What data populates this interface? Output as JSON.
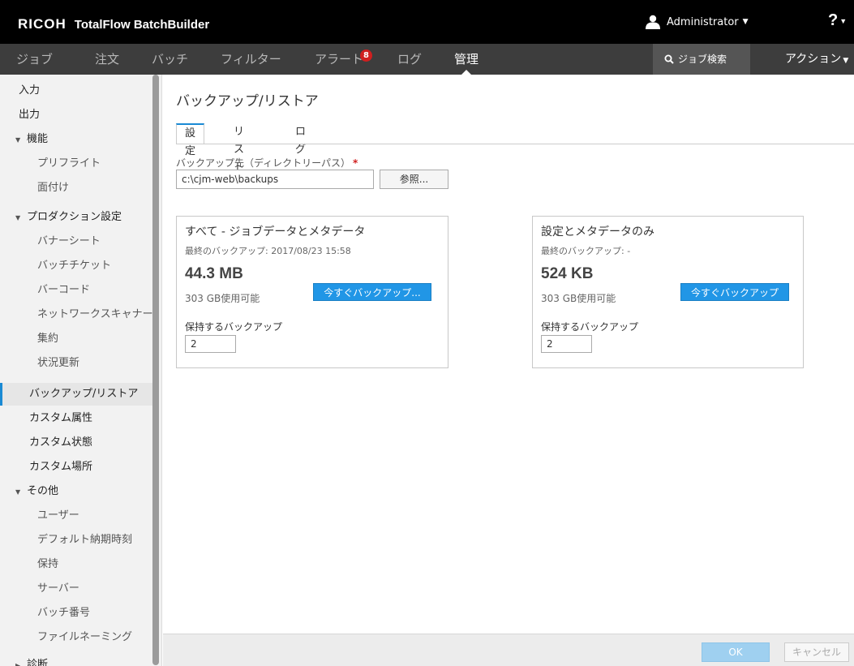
{
  "header": {
    "brand": "RICOH",
    "product": "TotalFlow BatchBuilder",
    "user": "Administrator",
    "help": "?"
  },
  "nav": {
    "items": [
      {
        "label": "ジョブ"
      },
      {
        "label": "注文"
      },
      {
        "label": "バッチ"
      },
      {
        "label": "フィルター"
      },
      {
        "label": "アラート",
        "badge": "8"
      },
      {
        "label": "ログ"
      },
      {
        "label": "管理",
        "active": true
      }
    ],
    "search_label": "ジョブ検索",
    "actions_label": "アクション"
  },
  "sidebar": {
    "items": [
      {
        "label": "入力"
      },
      {
        "label": "出力"
      },
      {
        "label": "機能",
        "expanded": true
      },
      {
        "label": "プリフライト"
      },
      {
        "label": "面付け"
      },
      {
        "label": "プロダクション設定",
        "expanded": true
      },
      {
        "label": "バナーシート"
      },
      {
        "label": "バッチチケット"
      },
      {
        "label": "バーコード"
      },
      {
        "label": "ネットワークスキャナー"
      },
      {
        "label": "集約"
      },
      {
        "label": "状況更新"
      },
      {
        "label": "バックアップ/リストア",
        "selected": true
      },
      {
        "label": "カスタム属性"
      },
      {
        "label": "カスタム状態"
      },
      {
        "label": "カスタム場所"
      },
      {
        "label": "その他",
        "expanded": true
      },
      {
        "label": "ユーザー"
      },
      {
        "label": "デフォルト納期時刻"
      },
      {
        "label": "保持"
      },
      {
        "label": "サーバー"
      },
      {
        "label": "バッチ番号"
      },
      {
        "label": "ファイルネーミング"
      },
      {
        "label": "診断"
      }
    ]
  },
  "main": {
    "title": "バックアップ/リストア",
    "tabs": [
      {
        "label": "設定",
        "active": true
      },
      {
        "label": "リストア"
      },
      {
        "label": "ログ"
      }
    ],
    "destination_label": "バックアップ先（ディレクトリーパス）",
    "required_mark": "*",
    "destination_value": "c:\\cjm-web\\backups",
    "browse_label": "参照...",
    "cards": [
      {
        "title": "すべて - ジョブデータとメタデータ",
        "last_backup": "最終のバックアップ: 2017/08/23 15:58",
        "size": "44.3 MB",
        "available": "303 GB使用可能",
        "button": "今すぐバックアップ...",
        "keep_label": "保持するバックアップ",
        "keep_value": "2"
      },
      {
        "title": "設定とメタデータのみ",
        "last_backup": "最終のバックアップ: -",
        "size": "524 KB",
        "available": "303 GB使用可能",
        "button": "今すぐバックアップ",
        "keep_label": "保持するバックアップ",
        "keep_value": "2"
      }
    ]
  },
  "footer": {
    "ok": "OK",
    "cancel": "キャンセル"
  },
  "colors": {
    "accent": "#1a8ad4",
    "button_blue": "#2196e6",
    "alert_red": "#d01f1f"
  }
}
